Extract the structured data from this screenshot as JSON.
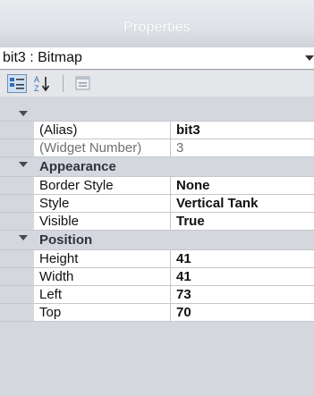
{
  "header": {
    "title": "Properties"
  },
  "object_selector": {
    "value": "bit3 : Bitmap"
  },
  "toolbar": {
    "buttons": [
      "categorized-icon",
      "alphabetical-icon",
      "property-pages-icon"
    ]
  },
  "grid": {
    "general": {
      "alias": {
        "name": "(Alias)",
        "value": "bit3"
      },
      "widget_number": {
        "name": "(Widget Number)",
        "value": "3"
      }
    },
    "appearance": {
      "label": "Appearance",
      "border_style": {
        "name": "Border Style",
        "value": "None"
      },
      "style": {
        "name": "Style",
        "value": "Vertical Tank"
      },
      "visible": {
        "name": "Visible",
        "value": "True"
      }
    },
    "position": {
      "label": "Position",
      "height": {
        "name": "Height",
        "value": "41"
      },
      "width": {
        "name": "Width",
        "value": "41"
      },
      "left": {
        "name": "Left",
        "value": "73"
      },
      "top": {
        "name": "Top",
        "value": "70"
      }
    }
  }
}
